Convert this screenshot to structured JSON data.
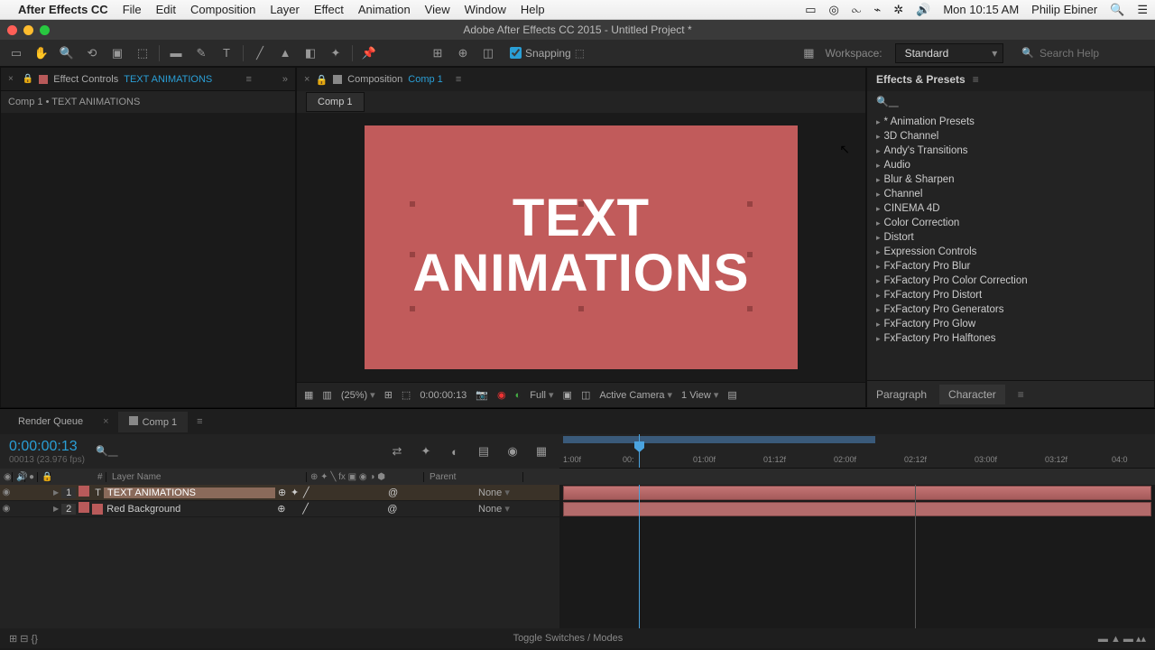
{
  "mac_menu": {
    "app": "After Effects CC",
    "items": [
      "File",
      "Edit",
      "Composition",
      "Layer",
      "Effect",
      "Animation",
      "View",
      "Window",
      "Help"
    ],
    "clock": "Mon 10:15 AM",
    "user": "Philip Ebiner"
  },
  "window_title": "Adobe After Effects CC 2015 - Untitled Project *",
  "toolbar": {
    "snapping": "Snapping",
    "workspace_label": "Workspace:",
    "workspace_value": "Standard",
    "search_placeholder": "Search Help"
  },
  "effect_controls": {
    "title": "Effect Controls",
    "link": "TEXT ANIMATIONS",
    "crumb": "Comp 1 • TEXT ANIMATIONS"
  },
  "composition": {
    "title": "Composition",
    "link": "Comp 1",
    "tab": "Comp 1",
    "text1": "TEXT",
    "text2": "ANIMATIONS"
  },
  "viewer_footer": {
    "zoom": "(25%)",
    "timecode": "0:00:00:13",
    "quality": "Full",
    "camera": "Active Camera",
    "view": "1 View"
  },
  "effects_presets": {
    "title": "Effects & Presets",
    "items": [
      "* Animation Presets",
      "3D Channel",
      "Andy's Transitions",
      "Audio",
      "Blur & Sharpen",
      "Channel",
      "CINEMA 4D",
      "Color Correction",
      "Distort",
      "Expression Controls",
      "FxFactory Pro Blur",
      "FxFactory Pro Color Correction",
      "FxFactory Pro Distort",
      "FxFactory Pro Generators",
      "FxFactory Pro Glow",
      "FxFactory Pro Halftones"
    ],
    "footer_tabs": [
      "Paragraph",
      "Character"
    ]
  },
  "timeline": {
    "render_queue": "Render Queue",
    "comp_tab": "Comp 1",
    "timecode": "0:00:00:13",
    "timecode_sub": "00013 (23.976 fps)",
    "header_layer": "Layer Name",
    "header_parent": "Parent",
    "ruler": [
      "1:00f",
      "00:",
      "01:00f",
      "01:12f",
      "02:00f",
      "02:12f",
      "03:00f",
      "03:12f",
      "04:0"
    ],
    "layers": [
      {
        "num": "1",
        "name": "TEXT ANIMATIONS",
        "color": "#b85a5a",
        "parent": "None",
        "type": "text"
      },
      {
        "num": "2",
        "name": "Red Background",
        "color": "#b85a5a",
        "parent": "None",
        "type": "solid"
      }
    ],
    "toggle": "Toggle Switches / Modes"
  }
}
